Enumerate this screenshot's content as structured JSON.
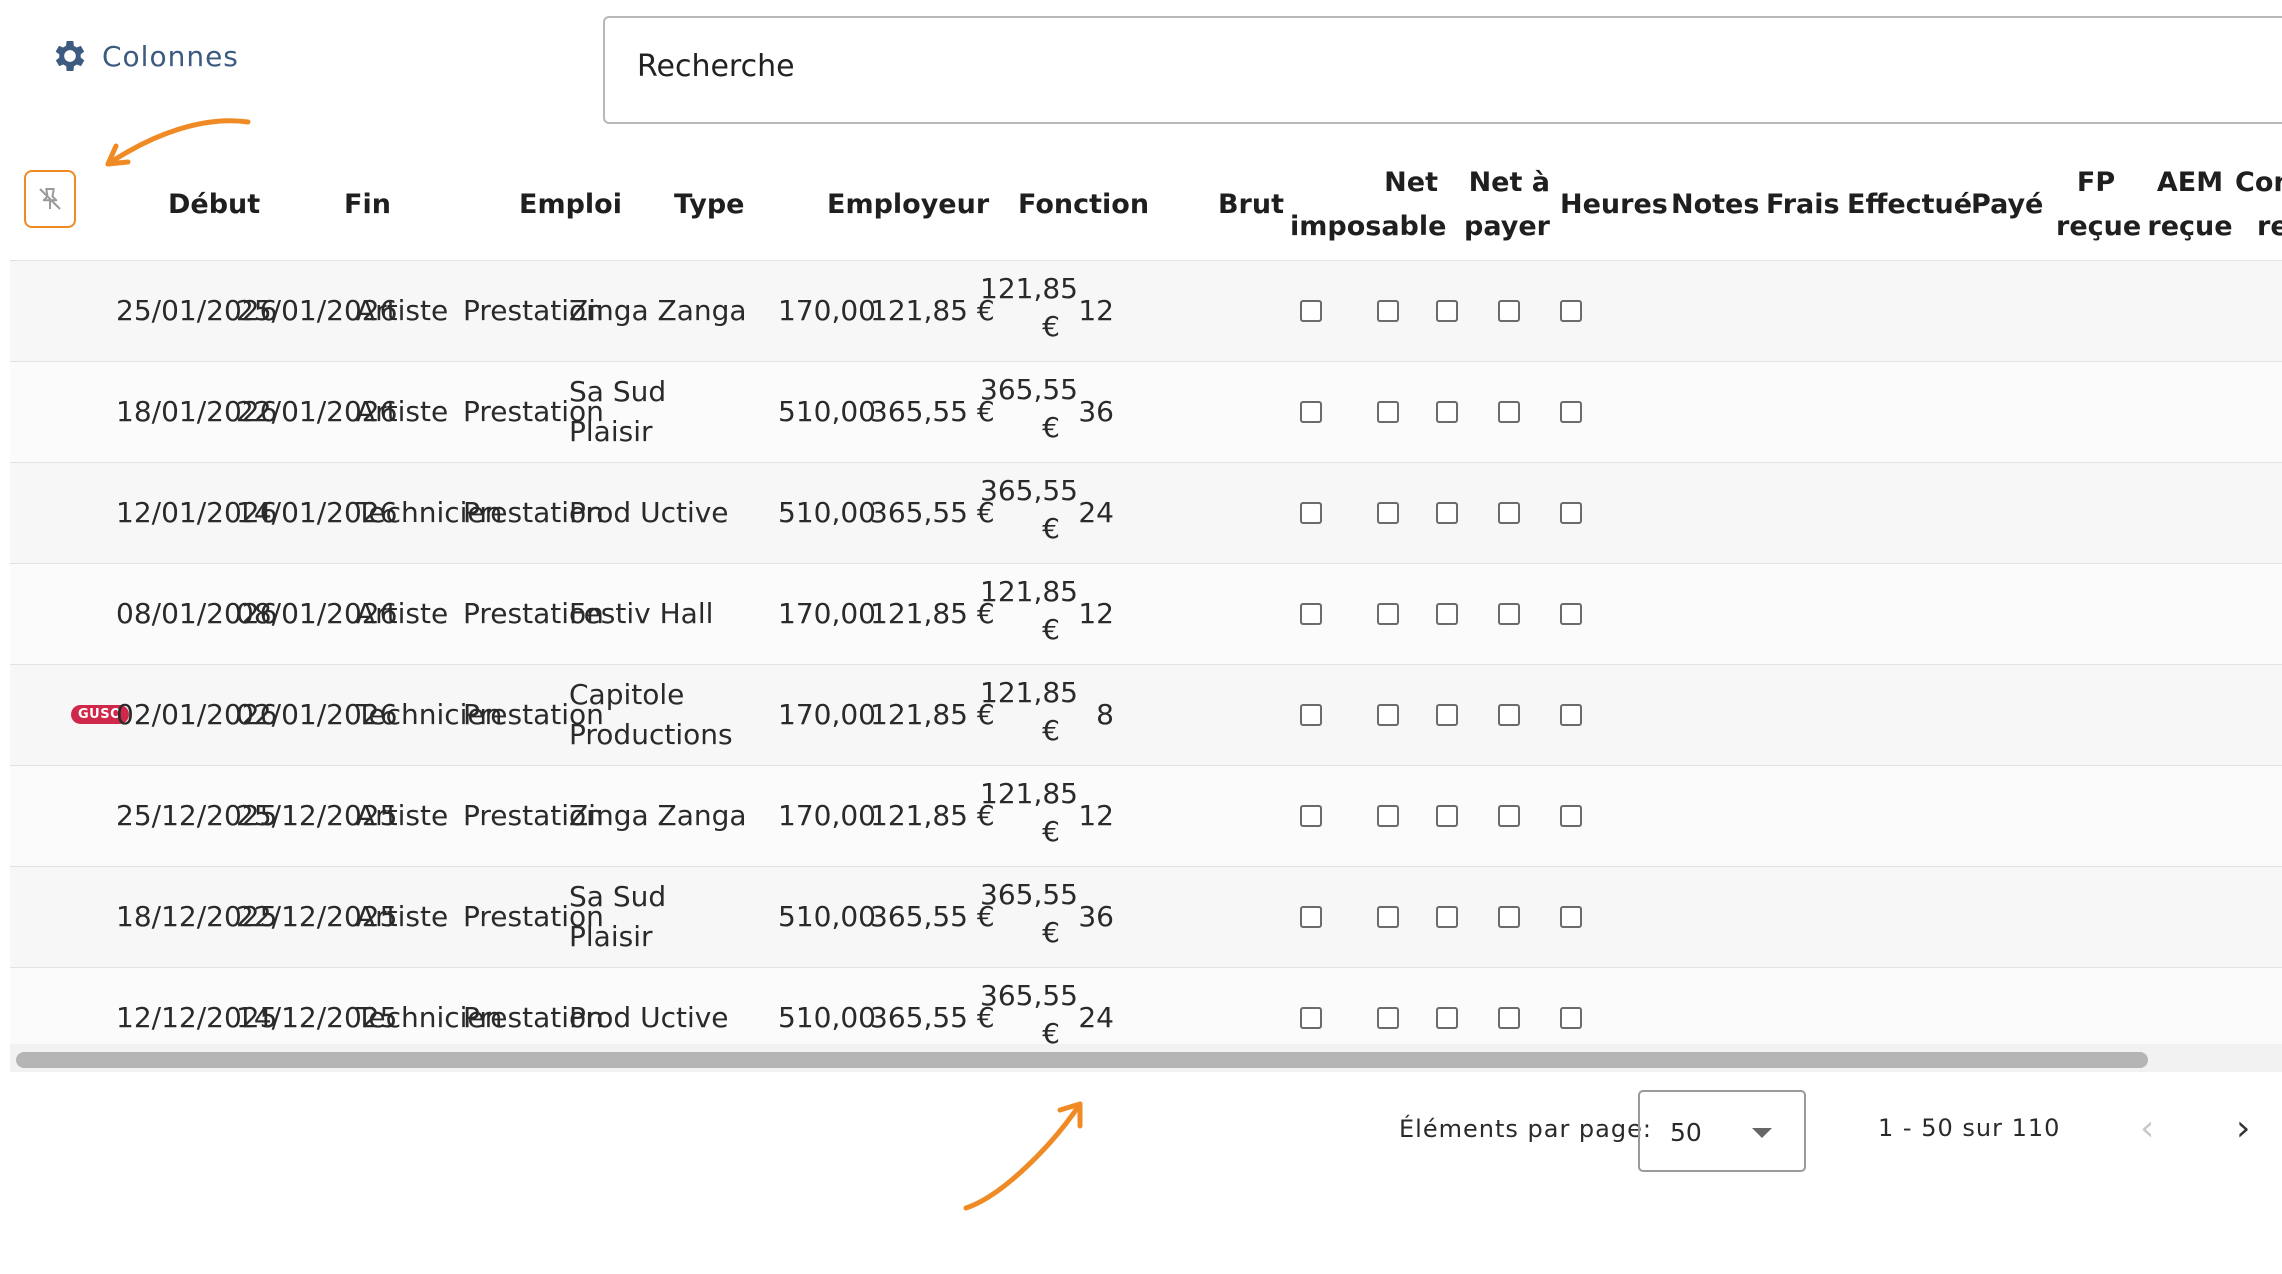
{
  "toolbar": {
    "columns_label": "Colonnes",
    "search_placeholder": "Recherche"
  },
  "table": {
    "headers": {
      "debut": "Début",
      "fin": "Fin",
      "emploi": "Emploi",
      "type": "Type",
      "employeur": "Employeur",
      "fonction": "Fonction",
      "brut": "Brut",
      "net_imposable_1": "Net",
      "net_imposable_2": "imposable",
      "net_payer_1": "Net à",
      "net_payer_2": "payer",
      "heures": "Heures",
      "notes": "Notes",
      "frais": "Frais",
      "effectue": "Effectué",
      "paye": "Payé",
      "fp_1": "FP",
      "fp_2": "reçue",
      "aem_1": "AEM",
      "aem_2": "reçue",
      "con_1": "Con",
      "con_2": "re"
    },
    "rows": [
      {
        "badge": "",
        "debut": "25/01/2026",
        "fin": "25/01/2026",
        "emploi": "Artiste",
        "type": "Prestation",
        "employeur_1": "Zinga Zanga",
        "employeur_2": "",
        "brut": "170,00",
        "net_imposable": "121,85 €",
        "net_payer_1": "121,85",
        "net_payer_2": "€",
        "heures": "12"
      },
      {
        "badge": "",
        "debut": "18/01/2026",
        "fin": "22/01/2026",
        "emploi": "Artiste",
        "type": "Prestation",
        "employeur_1": "Sa Sud",
        "employeur_2": "Plaisir",
        "brut": "510,00",
        "net_imposable": "365,55 €",
        "net_payer_1": "365,55",
        "net_payer_2": "€",
        "heures": "36"
      },
      {
        "badge": "",
        "debut": "12/01/2026",
        "fin": "14/01/2026",
        "emploi": "Technicien",
        "type": "Prestation",
        "employeur_1": "Prod Uctive",
        "employeur_2": "",
        "brut": "510,00",
        "net_imposable": "365,55 €",
        "net_payer_1": "365,55",
        "net_payer_2": "€",
        "heures": "24"
      },
      {
        "badge": "",
        "debut": "08/01/2026",
        "fin": "08/01/2026",
        "emploi": "Artiste",
        "type": "Prestation",
        "employeur_1": "Festiv Hall",
        "employeur_2": "",
        "brut": "170,00",
        "net_imposable": "121,85 €",
        "net_payer_1": "121,85",
        "net_payer_2": "€",
        "heures": "12"
      },
      {
        "badge": "GUSO",
        "debut": "02/01/2026",
        "fin": "02/01/2026",
        "emploi": "Technicien",
        "type": "Prestation",
        "employeur_1": "Capitole",
        "employeur_2": "Productions",
        "brut": "170,00",
        "net_imposable": "121,85 €",
        "net_payer_1": "121,85",
        "net_payer_2": "€",
        "heures": "8"
      },
      {
        "badge": "",
        "debut": "25/12/2025",
        "fin": "25/12/2025",
        "emploi": "Artiste",
        "type": "Prestation",
        "employeur_1": "Zinga Zanga",
        "employeur_2": "",
        "brut": "170,00",
        "net_imposable": "121,85 €",
        "net_payer_1": "121,85",
        "net_payer_2": "€",
        "heures": "12"
      },
      {
        "badge": "",
        "debut": "18/12/2025",
        "fin": "22/12/2025",
        "emploi": "Artiste",
        "type": "Prestation",
        "employeur_1": "Sa Sud",
        "employeur_2": "Plaisir",
        "brut": "510,00",
        "net_imposable": "365,55 €",
        "net_payer_1": "365,55",
        "net_payer_2": "€",
        "heures": "36"
      },
      {
        "badge": "",
        "debut": "12/12/2025",
        "fin": "14/12/2025",
        "emploi": "Technicien",
        "type": "Prestation",
        "employeur_1": "Prod Uctive",
        "employeur_2": "",
        "brut": "510,00",
        "net_imposable": "365,55 €",
        "net_payer_1": "365,55",
        "net_payer_2": "€",
        "heures": "24"
      }
    ]
  },
  "pagination": {
    "per_page_label": "Éléments par page:",
    "per_page_value": "50",
    "range_label": "1 - 50 sur 110",
    "prev_icon": "chevron-left-icon",
    "next_icon": "chevron-right-icon"
  },
  "colors": {
    "accent_orange": "#f08a24",
    "columns_blue": "#3d5a80",
    "guso_badge": "#d0284a"
  }
}
